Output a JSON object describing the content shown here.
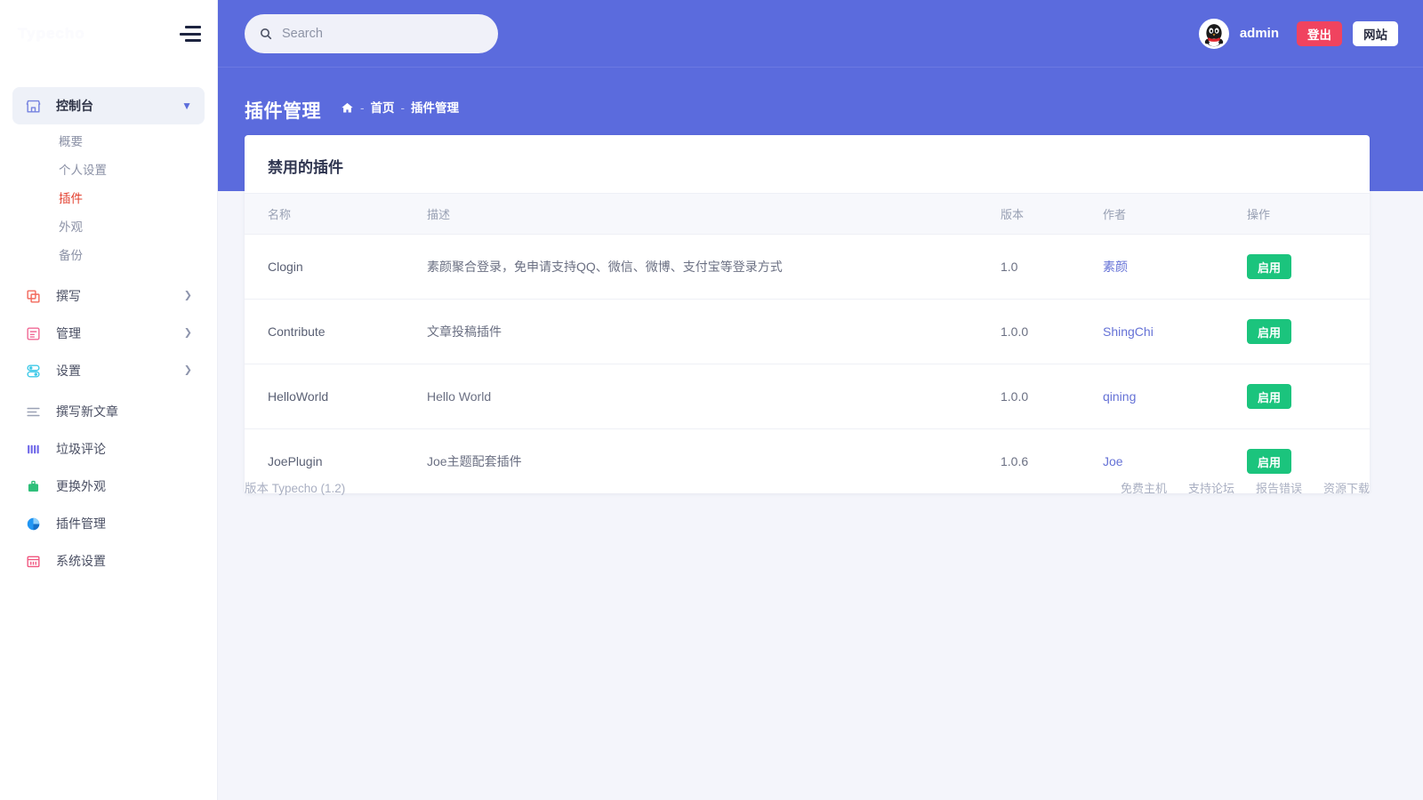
{
  "sidebar": {
    "logo_text": "Typecho",
    "menu_icon": "hamburger-icon",
    "groups": [
      {
        "label": "控制台",
        "icon": "dashboard-store-icon",
        "caret": "chevron-down-icon",
        "active": true,
        "children": [
          {
            "label": "概要",
            "current": false
          },
          {
            "label": "个人设置",
            "current": false
          },
          {
            "label": "插件",
            "current": true
          },
          {
            "label": "外观",
            "current": false
          },
          {
            "label": "备份",
            "current": false
          }
        ]
      },
      {
        "label": "撰写",
        "icon": "write-copy-icon",
        "caret": "chevron-right-icon",
        "active": false,
        "children": []
      },
      {
        "label": "管理",
        "icon": "manage-list-icon",
        "caret": "chevron-right-icon",
        "active": false,
        "children": []
      },
      {
        "label": "设置",
        "icon": "settings-toggle-icon",
        "caret": "chevron-right-icon",
        "active": false,
        "children": []
      }
    ],
    "links": [
      {
        "label": "撰写新文章",
        "icon": "lines-icon"
      },
      {
        "label": "垃圾评论",
        "icon": "bars-icon"
      },
      {
        "label": "更换外观",
        "icon": "paint-bucket-icon"
      },
      {
        "label": "插件管理",
        "icon": "pie-chart-icon"
      },
      {
        "label": "系统设置",
        "icon": "calendar-icon"
      }
    ]
  },
  "topbar": {
    "search": {
      "placeholder": "Search",
      "value": "",
      "icon": "search-icon"
    },
    "avatar_icon": "qq-penguin-avatar",
    "user_name": "admin",
    "logout_label": "登出",
    "site_label": "网站"
  },
  "page": {
    "title": "插件管理",
    "breadcrumb": {
      "home_icon": "home-icon",
      "sep": "-",
      "items": [
        "首页",
        "插件管理"
      ]
    }
  },
  "card": {
    "title": "禁用的插件",
    "columns": [
      "名称",
      "描述",
      "版本",
      "作者",
      "操作"
    ],
    "rows": [
      {
        "name": "Clogin",
        "description": "素颜聚合登录，免申请支持QQ、微信、微博、支付宝等登录方式",
        "version": "1.0",
        "author": "素颜",
        "action": "启用"
      },
      {
        "name": "Contribute",
        "description": "文章投稿插件",
        "version": "1.0.0",
        "author": "ShingChi",
        "action": "启用"
      },
      {
        "name": "HelloWorld",
        "description": "Hello World",
        "version": "1.0.0",
        "author": "qining",
        "action": "启用"
      },
      {
        "name": "JoePlugin",
        "description": "Joe主题配套插件",
        "version": "1.0.6",
        "author": "Joe",
        "action": "启用"
      }
    ]
  },
  "footer": {
    "version_text": "版本 Typecho (1.2)",
    "links": [
      "免费主机",
      "支持论坛",
      "报告错误",
      "资源下载"
    ]
  },
  "colors": {
    "brand": "#5b6bdd",
    "page_bg": "#f4f5fb",
    "enable_green": "#1bc47d",
    "logout_red": "#f0435f",
    "current_red": "#e3402f",
    "link_blue": "#6572d6"
  }
}
